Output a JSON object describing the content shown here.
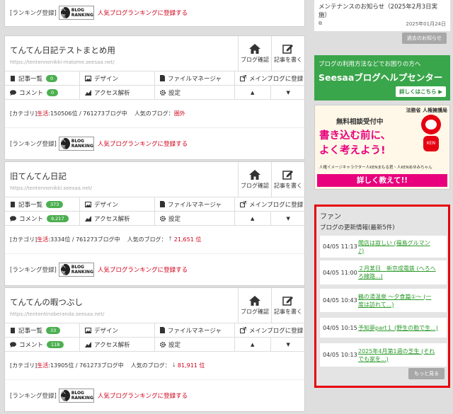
{
  "ranking": {
    "prefix": "[ランキング登録]",
    "logo_top": "BLOG",
    "logo_bottom": "RANKING",
    "logo_badge": "人気",
    "link": "人気ブログランキングに登録する"
  },
  "blog_buttons": {
    "view": "ブログ確認",
    "write": "記事を書く"
  },
  "menu_labels": {
    "articles": "記事一覧",
    "design": "デザイン",
    "file_manager": "ファイルマネージャ",
    "main_blog": "メインブログに登録",
    "comments": "コメント",
    "analytics": "アクセス解析",
    "settings": "設定",
    "up": "▲",
    "down": "▼"
  },
  "category_prefix": "[カテゴリ]",
  "category_name": "生活",
  "popular_label": "人気のブログ：",
  "blogs": [
    {
      "title": "てんてん日記テストまとめ用",
      "url": "https://tentennonikki-matome.seesaa.net/",
      "articles": "0",
      "comments": "0",
      "rank": ":150506位 / 761273ブログ中",
      "popular": "圏外",
      "arrow": ""
    },
    {
      "title": "旧てんてん日記",
      "url": "https://tentennonikki.seesaa.net/",
      "articles": "373",
      "comments": "9,217",
      "rank": ":3334位 / 761273ブログ中",
      "popular": "21,651 位",
      "arrow": "up"
    },
    {
      "title": "てんてんの暇つぶし",
      "url": "https://tententinoberanda.seesaa.net/",
      "articles": "33",
      "comments": "118",
      "rank": ":13905位 / 761273ブログ中",
      "popular": "81,911 位",
      "arrow": "down"
    }
  ],
  "notice": {
    "text": "メンテナンスのお知らせ（2025年2月3日実施）",
    "date": "2025年01月24日",
    "past_button": "過去のお知らせ"
  },
  "help_banner": {
    "line1": "ブログの利用方法などでお困りの方へ",
    "line2": "Seesaaブログヘルプセンター",
    "button": "詳しくはこちら ▶"
  },
  "ad_banner": {
    "corner": "法務省 人権擁護局",
    "head": "無料相談受付中",
    "main1": "書き込む前に、",
    "main2": "よく考えよう!",
    "caption": "人権イメージキャラクター人KENまもる君・人KENあゆみちゃん",
    "button": "詳しく教えて!!",
    "mascot": "KEN"
  },
  "fan": {
    "title": "ファン",
    "subtitle": "ブログの更新情報(最新5件)",
    "items": [
      {
        "time": "04/05 11:13",
        "l1": "聞店は寂しい (福島グルマン",
        "l2": "♪)"
      },
      {
        "time": "04/05 11:00",
        "l1": "２月某日　新京成電鉄 (へろへ",
        "l2": "ろ線路...)"
      },
      {
        "time": "04/05 10:43",
        "l1": "鶴の湯温泉 〜夕食篇①〜 (一",
        "l2": "度は訪れて...)"
      },
      {
        "time": "04/05 10:15",
        "l1": "予知夢part１ (野生の勘で生...)",
        "l2": ""
      },
      {
        "time": "04/05 10:13",
        "l1": "2025年4月第1週の芝生 (それ",
        "l2": "でも家を...)"
      }
    ],
    "more": "もっと見る"
  },
  "colors": {
    "accent_red": "#d0021b",
    "badge_green": "#4caf50",
    "help_green": "#3aa64b",
    "highlight_border": "#e8000b"
  }
}
